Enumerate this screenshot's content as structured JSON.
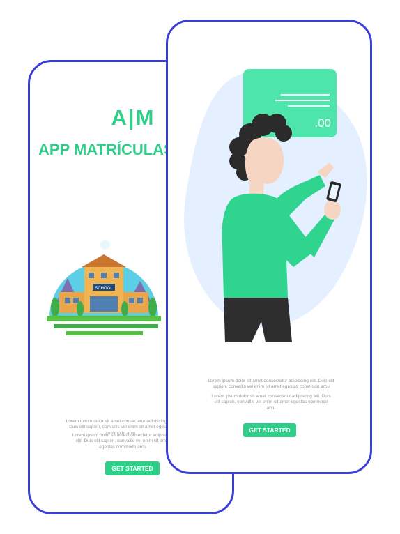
{
  "splash": {
    "logo": "A|M",
    "app_name": "APP MATRÍCULAS",
    "school_sign": "SCHOOL",
    "paragraph1": "Lorem ipsum dolor sit amet consectetur adipiscing elit. Duis elit sapien, convallis vel enim sit amet egestas commodo arcu",
    "paragraph2": "Lorem ipsum dolor sit amet consectetur adipiscing elit. Duis elit sapien, convallis vel enim sit amet egestas commodo arcu",
    "button": "GET STARTED"
  },
  "onboarding": {
    "card_amount": ".00",
    "paragraph1": "Lorem ipsum dolor sit amet consectetur adipiscing elit. Duis elit sapien, convallis vel enim sit amet egestas commodo arcu",
    "paragraph2": "Lorem ipsum dolor sit amet consectetur adipiscing elit. Duis elit sapien, convallis vel enim sit amet egestas commodo arcu",
    "button": "GET STARTED"
  },
  "colors": {
    "accent": "#2fcf8a",
    "frame": "#3b3fd9",
    "card": "#4ee5ab",
    "blob": "#e4efff"
  }
}
